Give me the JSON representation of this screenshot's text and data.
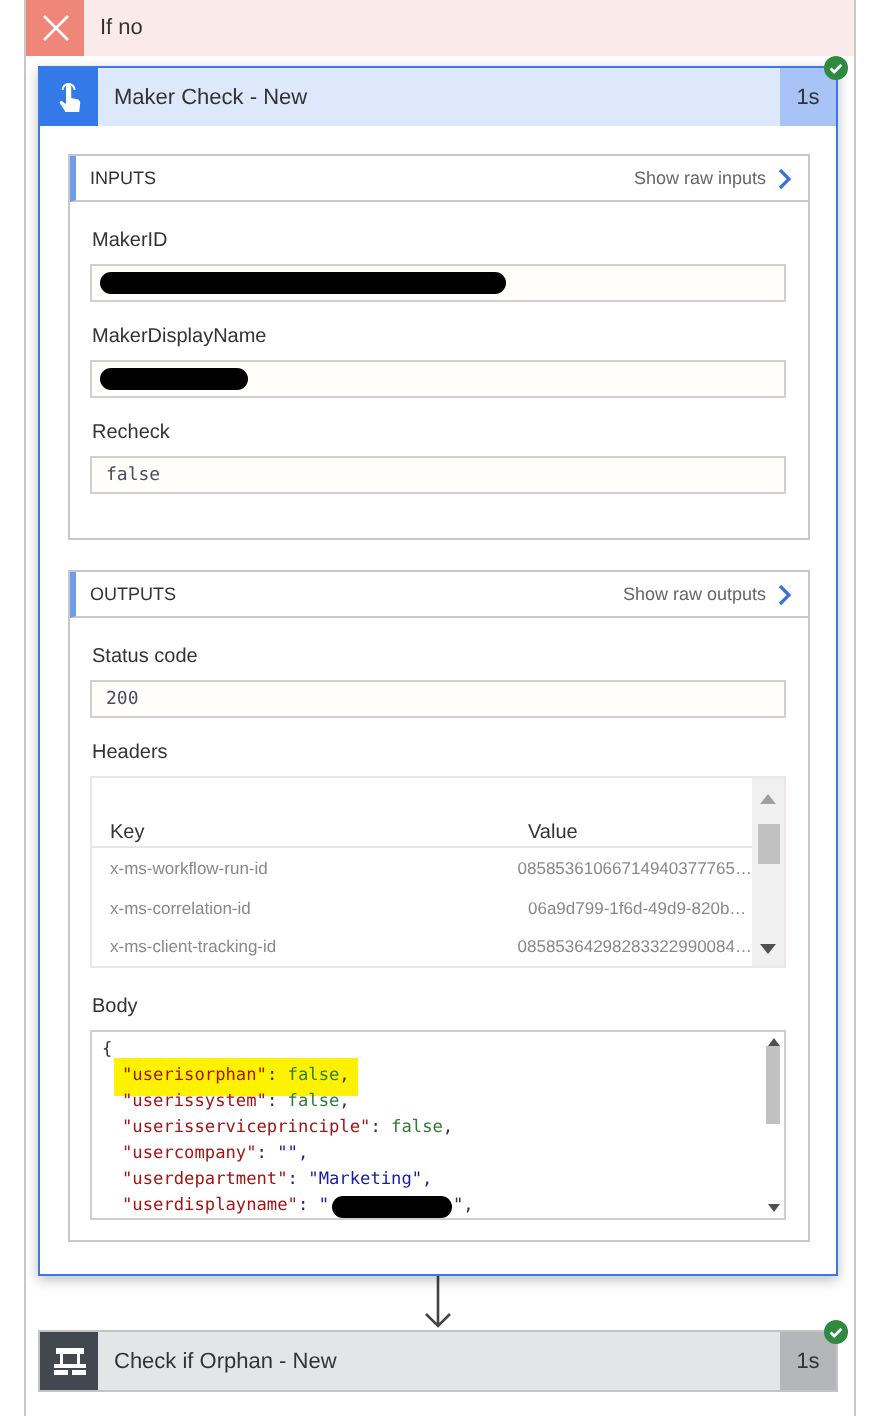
{
  "scope": {
    "title": "If no",
    "kind": "false_branch"
  },
  "actions": [
    {
      "kind": "detail",
      "title": "Maker Check - New",
      "duration": "1s",
      "succeeded": true,
      "inputs": {
        "heading": "INPUTS",
        "raw_link": "Show raw inputs",
        "fields": [
          {
            "label": "MakerID",
            "redacted": true
          },
          {
            "label": "MakerDisplayName",
            "redacted": true
          },
          {
            "label": "Recheck",
            "value": "false",
            "redacted": false
          }
        ]
      },
      "outputs": {
        "heading": "OUTPUTS",
        "raw_link": "Show raw outputs",
        "status": {
          "label": "Status code",
          "value": "200"
        },
        "headers": {
          "label": "Headers",
          "columns": [
            "Key",
            "Value"
          ],
          "rows": [
            [
              "x-ms-workflow-run-id",
              "08585361066714940377765…"
            ],
            [
              "x-ms-correlation-id",
              "06a9d799-1f6d-49d9-820b…"
            ],
            [
              "x-ms-client-tracking-id",
              "08585364298283322990084…"
            ]
          ]
        },
        "body": {
          "label": "Body",
          "lines": [
            {
              "text": "{",
              "highlighted": false,
              "redacted": false
            },
            {
              "text": "\"userisorphan\": false,",
              "highlighted": true,
              "redacted": false
            },
            {
              "text": "\"userissystem\": false,",
              "highlighted": false,
              "redacted": false
            },
            {
              "text": "\"userisserviceprinciple\": false,",
              "highlighted": false,
              "redacted": false
            },
            {
              "text": "\"usercompany\": \"\",",
              "highlighted": false,
              "redacted": false
            },
            {
              "text": "\"userdepartment\": \"Marketing\",",
              "highlighted": false,
              "redacted": false
            },
            {
              "text": "\"userdisplayname\": \"",
              "after": "\",",
              "highlighted": false,
              "redacted": true
            }
          ]
        }
      }
    },
    {
      "kind": "collapsed",
      "title": "Check if Orphan - New",
      "duration": "1s",
      "succeeded": true
    }
  ]
}
